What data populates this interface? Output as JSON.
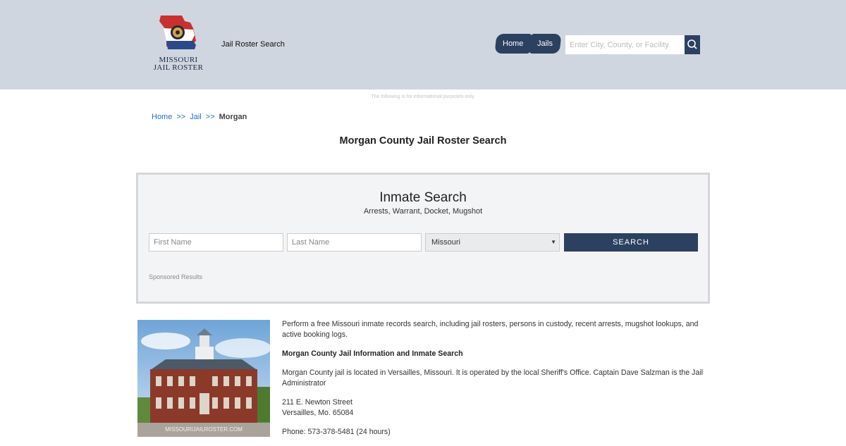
{
  "header": {
    "logo_line1": "MISSOURI",
    "logo_line2": "JAIL ROSTER",
    "site_title": "Jail Roster Search",
    "nav": [
      {
        "label": "Home"
      },
      {
        "label": "Jails"
      }
    ],
    "search_placeholder": "Enter City, County, or Facility",
    "bg_color": "#cfd6df",
    "accent_color": "#2c4060"
  },
  "disclaimer": "The following is for informational purposes only.",
  "breadcrumb": {
    "home": "Home",
    "sep": ">>",
    "jail": "Jail",
    "current": "Morgan"
  },
  "page_title": "Morgan County Jail Roster Search",
  "inmate_search": {
    "title": "Inmate Search",
    "subtitle": "Arrests, Warrant, Docket, Mugshot",
    "first_placeholder": "First Name",
    "last_placeholder": "Last Name",
    "state_value": "Missouri",
    "button_label": "SEARCH",
    "sponsored": "Sponsored Results"
  },
  "photo_watermark": "MISSOURIJAILROSTER.COM",
  "content": {
    "intro": "Perform a free Missouri inmate records search, including jail rosters, persons in custody, recent arrests, mugshot lookups, and active booking logs.",
    "heading": "Morgan County Jail Information and Inmate Search",
    "description": "Morgan County jail is located in Versailles, Missouri. It is operated by the local Sheriff's Office. Captain Dave Salzman is the Jail Administrator",
    "address_line1": "211 E. Newton Street",
    "address_line2": "Versailles, Mo. 65084",
    "phone": "Phone: 573-378-5481 (24 hours)"
  }
}
